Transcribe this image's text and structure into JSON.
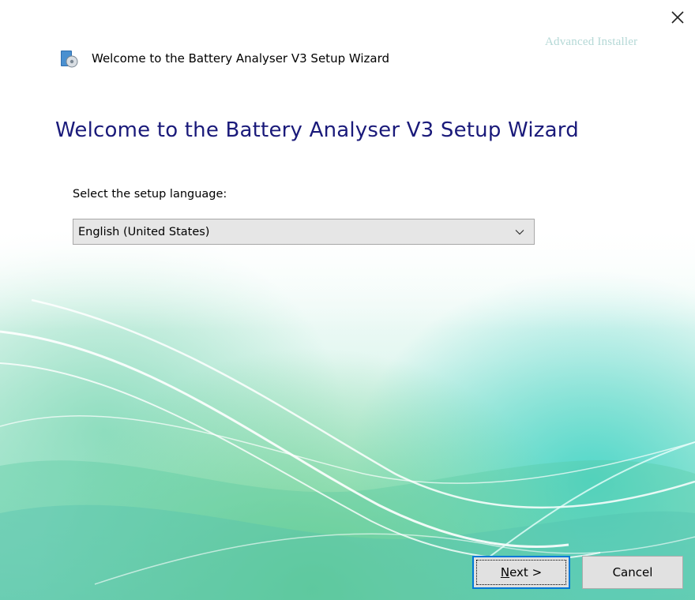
{
  "window": {
    "title": "Welcome to the Battery Analyser V3 Setup Wizard",
    "brand": "Advanced Installer",
    "close_icon": "close-icon"
  },
  "main": {
    "heading": "Welcome to the Battery Analyser V3 Setup Wizard",
    "language_label": "Select the setup language:",
    "language_selected": "English (United States)"
  },
  "buttons": {
    "next_mnemonic": "N",
    "next_rest": "ext >",
    "cancel": "Cancel"
  },
  "colors": {
    "heading": "#1a1a7a",
    "accent_focus": "#0078d7",
    "background_wave": "#6fe0c9"
  }
}
